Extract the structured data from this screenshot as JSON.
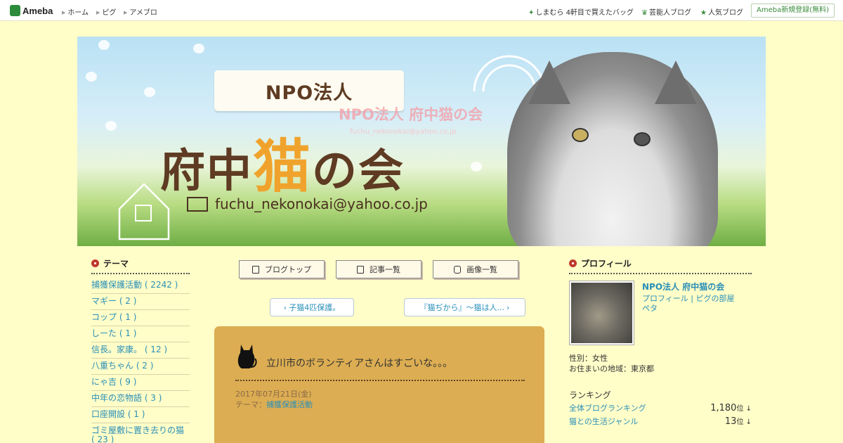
{
  "topbar": {
    "logo": "Ameba",
    "nav": [
      "ホーム",
      "ピグ",
      "アメブロ"
    ],
    "right_links": [
      "しまむら 4軒目で買えたバッグ",
      "芸能人ブログ",
      "人気ブログ"
    ],
    "register": "Ameba新規登録(無料)"
  },
  "header": {
    "ribbon": "NPO法人",
    "title_pre": "府中",
    "title_neko": "猫",
    "title_post": "の会",
    "email": "fuchu_nekonokai@yahoo.co.jp",
    "overlay_title": "NPO法人 府中猫の会",
    "overlay_sub": "fuchu_nekonokai@yahoo.co.jp"
  },
  "theme": {
    "heading": "テーマ",
    "items": [
      "捕獲保護活動 ( 2242 )",
      "マギー ( 2 )",
      "コップ ( 1 )",
      "しーた ( 1 )",
      "信長。家康。 ( 12 )",
      "八重ちゃん ( 2 )",
      "にゃ吉 ( 9 )",
      "中年の恋物語 ( 3 )",
      "口座開設 ( 1 )",
      "ゴミ屋敷に置き去りの猫 ( 23 )"
    ]
  },
  "tabs": [
    "ブログトップ",
    "記事一覧",
    "画像一覧"
  ],
  "postnav": {
    "prev": "子猫4匹保護。",
    "next": "『猫ぢから』〜猫は人..."
  },
  "article": {
    "title": "立川市のボランティアさんはすごいな。。。",
    "date": "2017年07月21日(金)",
    "theme_label": "テーマ：",
    "theme_link": "捕獲保護活動"
  },
  "profile": {
    "heading": "プロフィール",
    "name": "NPO法人 府中猫の会",
    "links": [
      "プロフィール",
      "ピグの部屋",
      "ペタ"
    ],
    "sex": "性別：女性",
    "area": "お住まいの地域：東京都"
  },
  "ranking": {
    "heading": "ランキング",
    "rows": [
      {
        "label": "全体ブログランキング",
        "value": "1,180",
        "unit": "位"
      },
      {
        "label": "猫との生活ジャンル",
        "value": "13",
        "unit": "位"
      }
    ]
  },
  "colors": {
    "page_bg": "#fffdc8",
    "article_bg": "#dcad52",
    "link": "#2a8fb8",
    "accent_orange": "#f0a32c",
    "ameba_green": "#2d8c3c"
  }
}
